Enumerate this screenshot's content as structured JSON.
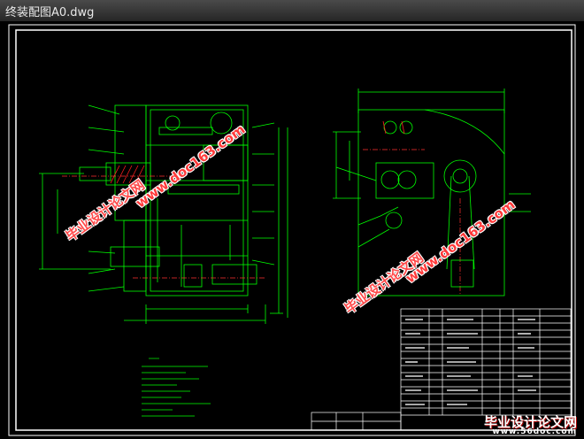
{
  "window": {
    "title": "终装配图A0.dwg"
  },
  "watermarks": {
    "cn_text": "毕业设计论文网",
    "url_text": "www.doc163.com"
  },
  "corner_logo": {
    "cn_text": "毕业设计论文网",
    "url_text": "www.56doc.com"
  },
  "colors": {
    "background": "#000000",
    "frame": "#ffffff",
    "geometry": "#00ff00",
    "dimension": "#00ff00",
    "center_line": "#ff3030",
    "hatch": "#ff2020",
    "watermark": "#ff3a3a"
  }
}
